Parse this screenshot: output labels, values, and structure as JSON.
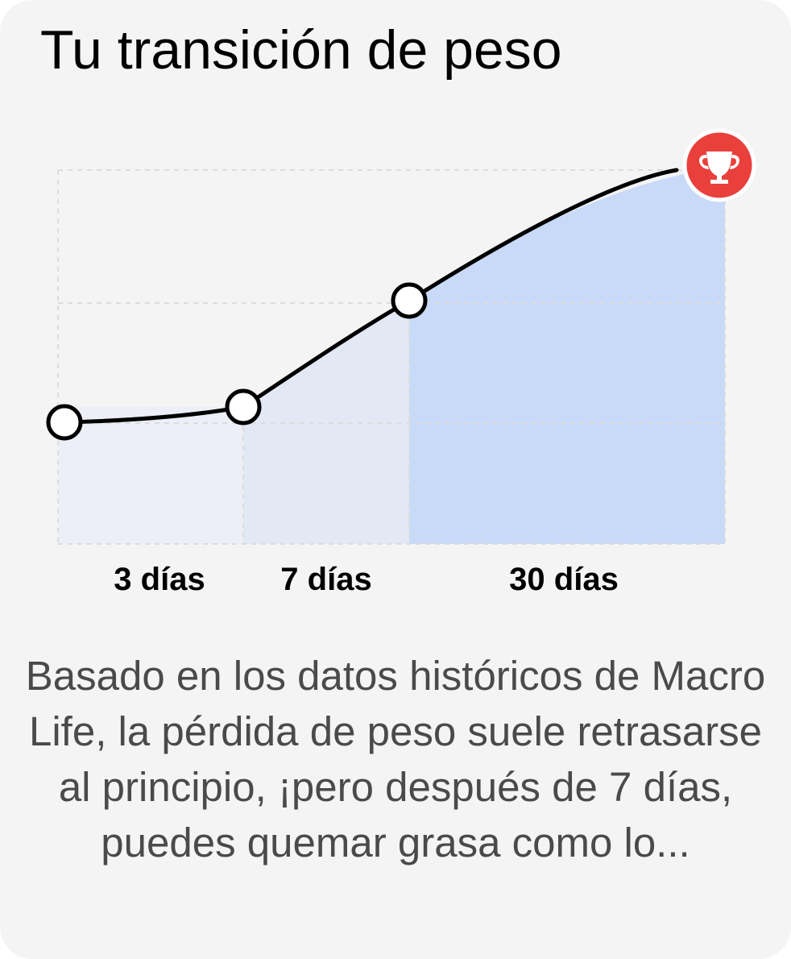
{
  "card": {
    "title": "Tu transición de peso",
    "description": "Basado en los datos históricos de Macro Life, la pérdida de peso suele retrasarse al principio, ¡pero después de 7 días, puedes quemar grasa como lo..."
  },
  "chart_data": {
    "type": "area",
    "title": "",
    "xlabel": "",
    "ylabel": "",
    "grid": true,
    "segments": [
      {
        "label": "3 días",
        "fill": "#eceff7"
      },
      {
        "label": "7 días",
        "fill": "#e3e8f5"
      },
      {
        "label": "30 días",
        "fill": "#c8daf7"
      }
    ],
    "points": [
      {
        "day": 0,
        "marker": "circle"
      },
      {
        "day": 3,
        "marker": "circle"
      },
      {
        "day": 7,
        "marker": "circle"
      },
      {
        "day": 30,
        "marker": "trophy"
      }
    ],
    "line_color": "#000000",
    "goal_icon": "trophy-icon",
    "goal_color": "#e9403c"
  }
}
